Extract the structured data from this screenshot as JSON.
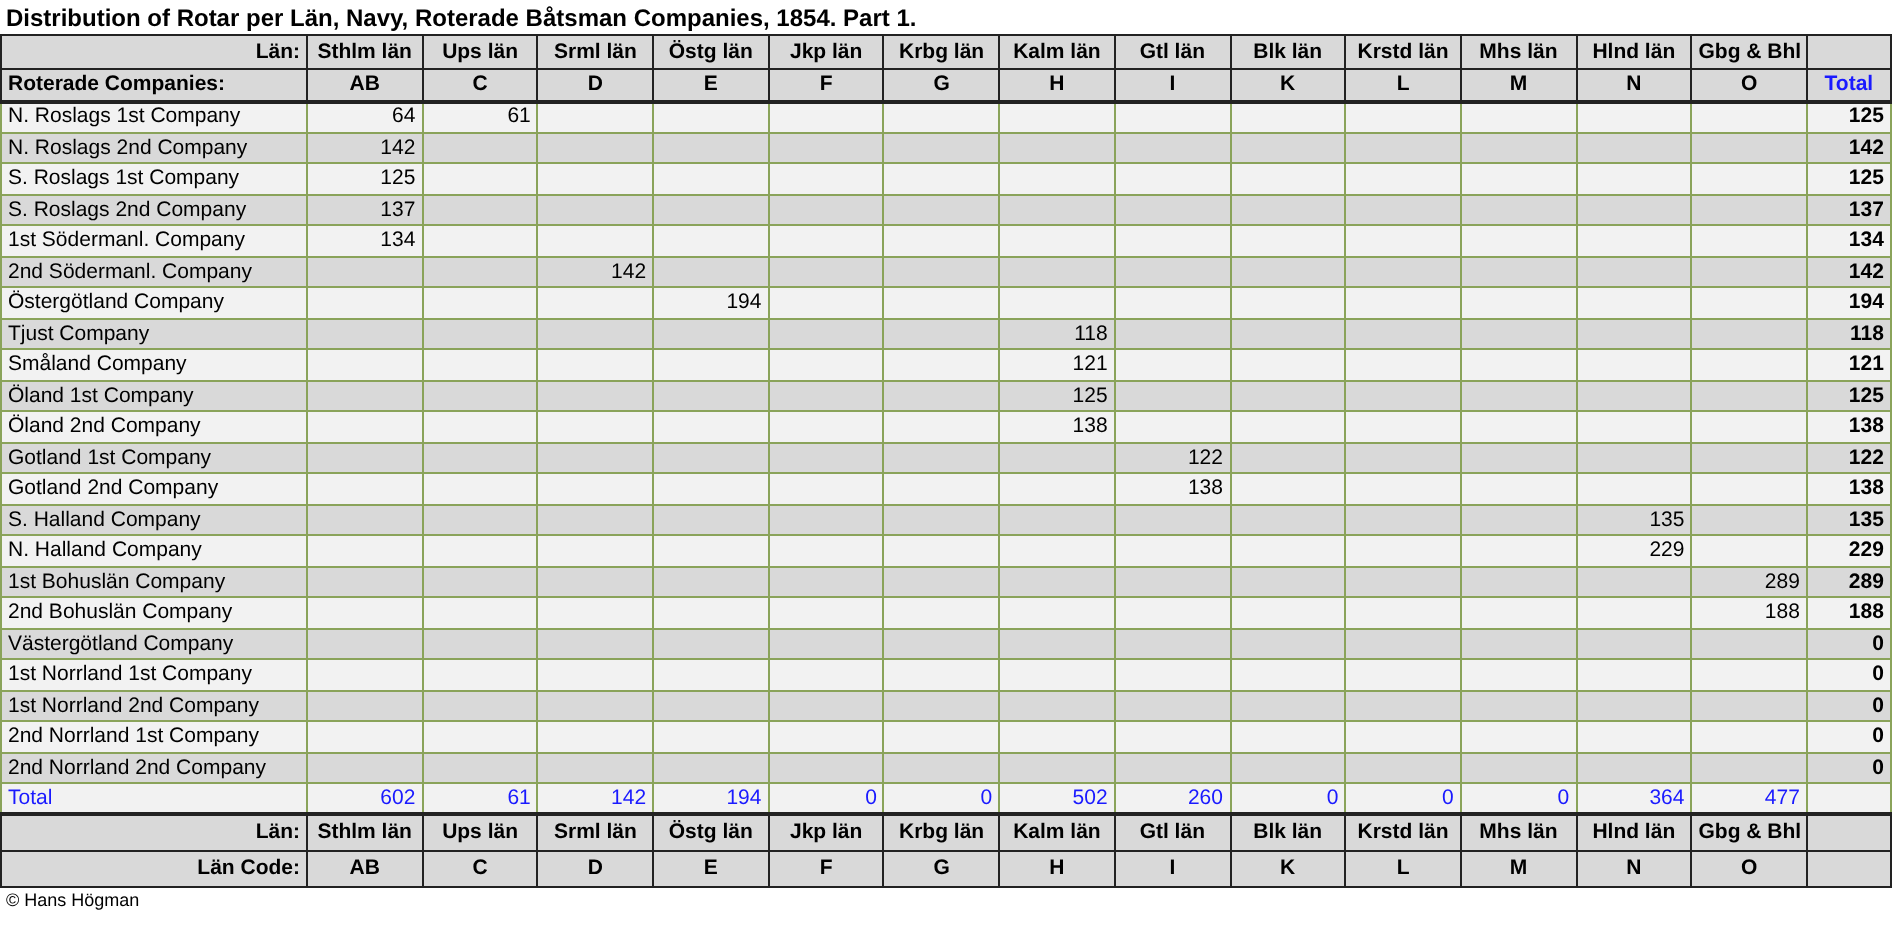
{
  "title": "Distribution of Rotar per Län, Navy, Roterade Båtsman Companies, 1854. Part 1.",
  "header": {
    "lan_label": "Län:",
    "companies_label": "Roterade Companies:",
    "total_label": "Total"
  },
  "columns": [
    {
      "lan": "Sthlm län",
      "code": "AB"
    },
    {
      "lan": "Ups län",
      "code": "C"
    },
    {
      "lan": "Srml län",
      "code": "D"
    },
    {
      "lan": "Östg län",
      "code": "E"
    },
    {
      "lan": "Jkp län",
      "code": "F"
    },
    {
      "lan": "Krbg län",
      "code": "G"
    },
    {
      "lan": "Kalm län",
      "code": "H"
    },
    {
      "lan": "Gtl län",
      "code": "I"
    },
    {
      "lan": "Blk län",
      "code": "K"
    },
    {
      "lan": "Krstd län",
      "code": "L"
    },
    {
      "lan": "Mhs län",
      "code": "M"
    },
    {
      "lan": "Hlnd län",
      "code": "N"
    },
    {
      "lan": "Gbg & Bhl",
      "code": "O"
    }
  ],
  "rows": [
    {
      "name": "N. Roslags 1st Company",
      "cells": [
        "64",
        "61",
        null,
        null,
        null,
        null,
        null,
        null,
        null,
        null,
        null,
        null,
        null
      ],
      "total": "125"
    },
    {
      "name": "N. Roslags 2nd Company",
      "cells": [
        "142",
        null,
        null,
        null,
        null,
        null,
        null,
        null,
        null,
        null,
        null,
        null,
        null
      ],
      "total": "142"
    },
    {
      "name": "S. Roslags 1st Company",
      "cells": [
        "125",
        null,
        null,
        null,
        null,
        null,
        null,
        null,
        null,
        null,
        null,
        null,
        null
      ],
      "total": "125"
    },
    {
      "name": "S. Roslags 2nd Company",
      "cells": [
        "137",
        null,
        null,
        null,
        null,
        null,
        null,
        null,
        null,
        null,
        null,
        null,
        null
      ],
      "total": "137"
    },
    {
      "name": "1st Södermanl. Company",
      "cells": [
        "134",
        null,
        null,
        null,
        null,
        null,
        null,
        null,
        null,
        null,
        null,
        null,
        null
      ],
      "total": "134"
    },
    {
      "name": "2nd Södermanl. Company",
      "cells": [
        null,
        null,
        "142",
        null,
        null,
        null,
        null,
        null,
        null,
        null,
        null,
        null,
        null
      ],
      "total": "142"
    },
    {
      "name": "Östergötland Company",
      "cells": [
        null,
        null,
        null,
        "194",
        null,
        null,
        null,
        null,
        null,
        null,
        null,
        null,
        null
      ],
      "total": "194"
    },
    {
      "name": "Tjust Company",
      "cells": [
        null,
        null,
        null,
        null,
        null,
        null,
        "118",
        null,
        null,
        null,
        null,
        null,
        null
      ],
      "total": "118"
    },
    {
      "name": "Småland Company",
      "cells": [
        null,
        null,
        null,
        null,
        null,
        null,
        "121",
        null,
        null,
        null,
        null,
        null,
        null
      ],
      "total": "121"
    },
    {
      "name": "Öland 1st Company",
      "cells": [
        null,
        null,
        null,
        null,
        null,
        null,
        "125",
        null,
        null,
        null,
        null,
        null,
        null
      ],
      "total": "125"
    },
    {
      "name": "Öland 2nd Company",
      "cells": [
        null,
        null,
        null,
        null,
        null,
        null,
        "138",
        null,
        null,
        null,
        null,
        null,
        null
      ],
      "total": "138"
    },
    {
      "name": "Gotland 1st Company",
      "cells": [
        null,
        null,
        null,
        null,
        null,
        null,
        null,
        "122",
        null,
        null,
        null,
        null,
        null
      ],
      "total": "122"
    },
    {
      "name": "Gotland 2nd Company",
      "cells": [
        null,
        null,
        null,
        null,
        null,
        null,
        null,
        "138",
        null,
        null,
        null,
        null,
        null
      ],
      "total": "138"
    },
    {
      "name": "S. Halland Company",
      "cells": [
        null,
        null,
        null,
        null,
        null,
        null,
        null,
        null,
        null,
        null,
        null,
        "135",
        null
      ],
      "total": "135"
    },
    {
      "name": "N. Halland Company",
      "cells": [
        null,
        null,
        null,
        null,
        null,
        null,
        null,
        null,
        null,
        null,
        null,
        "229",
        null
      ],
      "total": "229"
    },
    {
      "name": "1st Bohuslän Company",
      "cells": [
        null,
        null,
        null,
        null,
        null,
        null,
        null,
        null,
        null,
        null,
        null,
        null,
        "289"
      ],
      "total": "289"
    },
    {
      "name": "2nd Bohuslän Company",
      "cells": [
        null,
        null,
        null,
        null,
        null,
        null,
        null,
        null,
        null,
        null,
        null,
        null,
        "188"
      ],
      "total": "188"
    },
    {
      "name": "Västergötland Company",
      "cells": [
        null,
        null,
        null,
        null,
        null,
        null,
        null,
        null,
        null,
        null,
        null,
        null,
        null
      ],
      "total": "0"
    },
    {
      "name": "1st Norrland 1st Company",
      "cells": [
        null,
        null,
        null,
        null,
        null,
        null,
        null,
        null,
        null,
        null,
        null,
        null,
        null
      ],
      "total": "0"
    },
    {
      "name": "1st Norrland 2nd Company",
      "cells": [
        null,
        null,
        null,
        null,
        null,
        null,
        null,
        null,
        null,
        null,
        null,
        null,
        null
      ],
      "total": "0"
    },
    {
      "name": "2nd Norrland 1st Company",
      "cells": [
        null,
        null,
        null,
        null,
        null,
        null,
        null,
        null,
        null,
        null,
        null,
        null,
        null
      ],
      "total": "0"
    },
    {
      "name": "2nd Norrland 2nd Company",
      "cells": [
        null,
        null,
        null,
        null,
        null,
        null,
        null,
        null,
        null,
        null,
        null,
        null,
        null
      ],
      "total": "0"
    }
  ],
  "total_row": {
    "label": "Total",
    "cells": [
      "602",
      "61",
      "142",
      "194",
      "0",
      "0",
      "502",
      "260",
      "0",
      "0",
      "0",
      "364",
      "477"
    ]
  },
  "footer": {
    "lan_label": "Län:",
    "code_label": "Län Code:",
    "columns": [
      {
        "lan": "Sthlm län",
        "code": "AB"
      },
      {
        "lan": "Ups län",
        "code": "C"
      },
      {
        "lan": "Srml län",
        "code": "D"
      },
      {
        "lan": "Östg län",
        "code": "E"
      },
      {
        "lan": "Jkp län",
        "code": "F"
      },
      {
        "lan": "Krbg län",
        "code": "G"
      },
      {
        "lan": "Kalm län",
        "code": "H"
      },
      {
        "lan": "Gtl län",
        "code": "I"
      },
      {
        "lan": "Blk län",
        "code": "K"
      },
      {
        "lan": "Krstd län",
        "code": "L"
      },
      {
        "lan": "Mhs län",
        "code": "M"
      },
      {
        "lan": "Hlnd län",
        "code": "N"
      },
      {
        "lan": "Gbg & Bhl",
        "code": "O"
      }
    ]
  },
  "copyright": "© Hans Högman"
}
